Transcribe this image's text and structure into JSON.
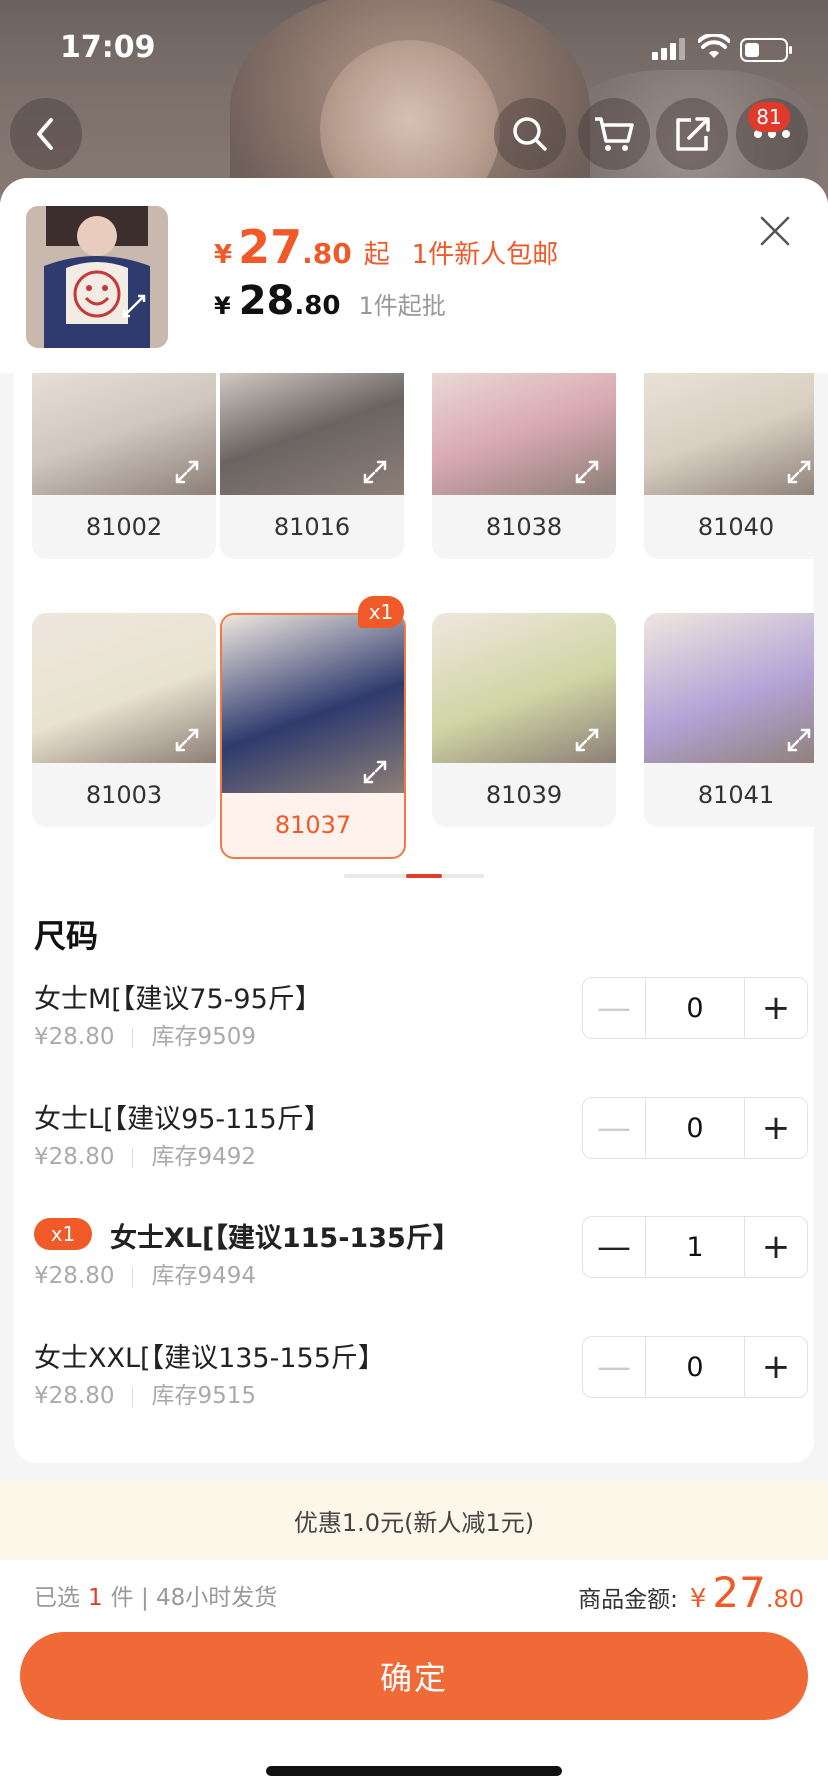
{
  "status_bar": {
    "time": "17:09"
  },
  "nav": {
    "cart_badge": "81"
  },
  "product": {
    "price_currency": "¥",
    "price_int": "27",
    "price_dec": ".80",
    "price_qi": "起",
    "new_user_tag": "1件新人包邮",
    "wholesale_currency": "¥",
    "wholesale_int": "28",
    "wholesale_dec": ".80",
    "moq": "1件起批"
  },
  "variants": [
    {
      "code": "81002",
      "selected": false,
      "icon": "expand-icon",
      "color": "#cfc6be"
    },
    {
      "code": "81016",
      "selected": false,
      "icon": "expand-icon",
      "color": "#6a6462"
    },
    {
      "code": "81038",
      "selected": false,
      "icon": "expand-icon",
      "color": "#d9a9b2"
    },
    {
      "code": "81040",
      "selected": false,
      "icon": "expand-icon",
      "color": "#d8cfc2"
    },
    {
      "code": "81003",
      "selected": false,
      "icon": "expand-icon",
      "color": "#e8e2cf"
    },
    {
      "code": "81037",
      "selected": true,
      "badge": "x1",
      "icon": "expand-icon",
      "color": "#2f3b6e"
    },
    {
      "code": "81039",
      "selected": false,
      "icon": "expand-icon",
      "color": "#cfd5a4"
    },
    {
      "code": "81041",
      "selected": false,
      "icon": "expand-icon",
      "color": "#b4a3d6"
    }
  ],
  "size_section": {
    "title": "尺码"
  },
  "sizes": [
    {
      "label": "女士M[【建议75-95斤】",
      "price": "¥28.80",
      "stock": "库存9509",
      "qty": "0",
      "minus": "—",
      "plus": "+",
      "selected": false
    },
    {
      "label": "女士L[【建议95-115斤】",
      "price": "¥28.80",
      "stock": "库存9492",
      "qty": "0",
      "minus": "—",
      "plus": "+",
      "selected": false
    },
    {
      "label": "女士XL[【建议115-135斤】",
      "price": "¥28.80",
      "stock": "库存9494",
      "qty": "1",
      "minus": "—",
      "plus": "+",
      "selected": true,
      "badge": "x1"
    },
    {
      "label": "女士XXL[【建议135-155斤】",
      "price": "¥28.80",
      "stock": "库存9515",
      "qty": "0",
      "minus": "—",
      "plus": "+",
      "selected": false
    }
  ],
  "promo": {
    "text": "优惠1.0元(新人减1元)"
  },
  "summary": {
    "prefix": "已选",
    "count": "1",
    "suffix": "件 | 48小时发货"
  },
  "total": {
    "label": "商品金额:",
    "currency": "¥",
    "int": "27",
    "dec": ".80"
  },
  "confirm": {
    "label": "确定"
  },
  "colors": {
    "accent": "#ef5a28",
    "button": "#ef6a36",
    "promo_bg": "#fdf7ea"
  }
}
